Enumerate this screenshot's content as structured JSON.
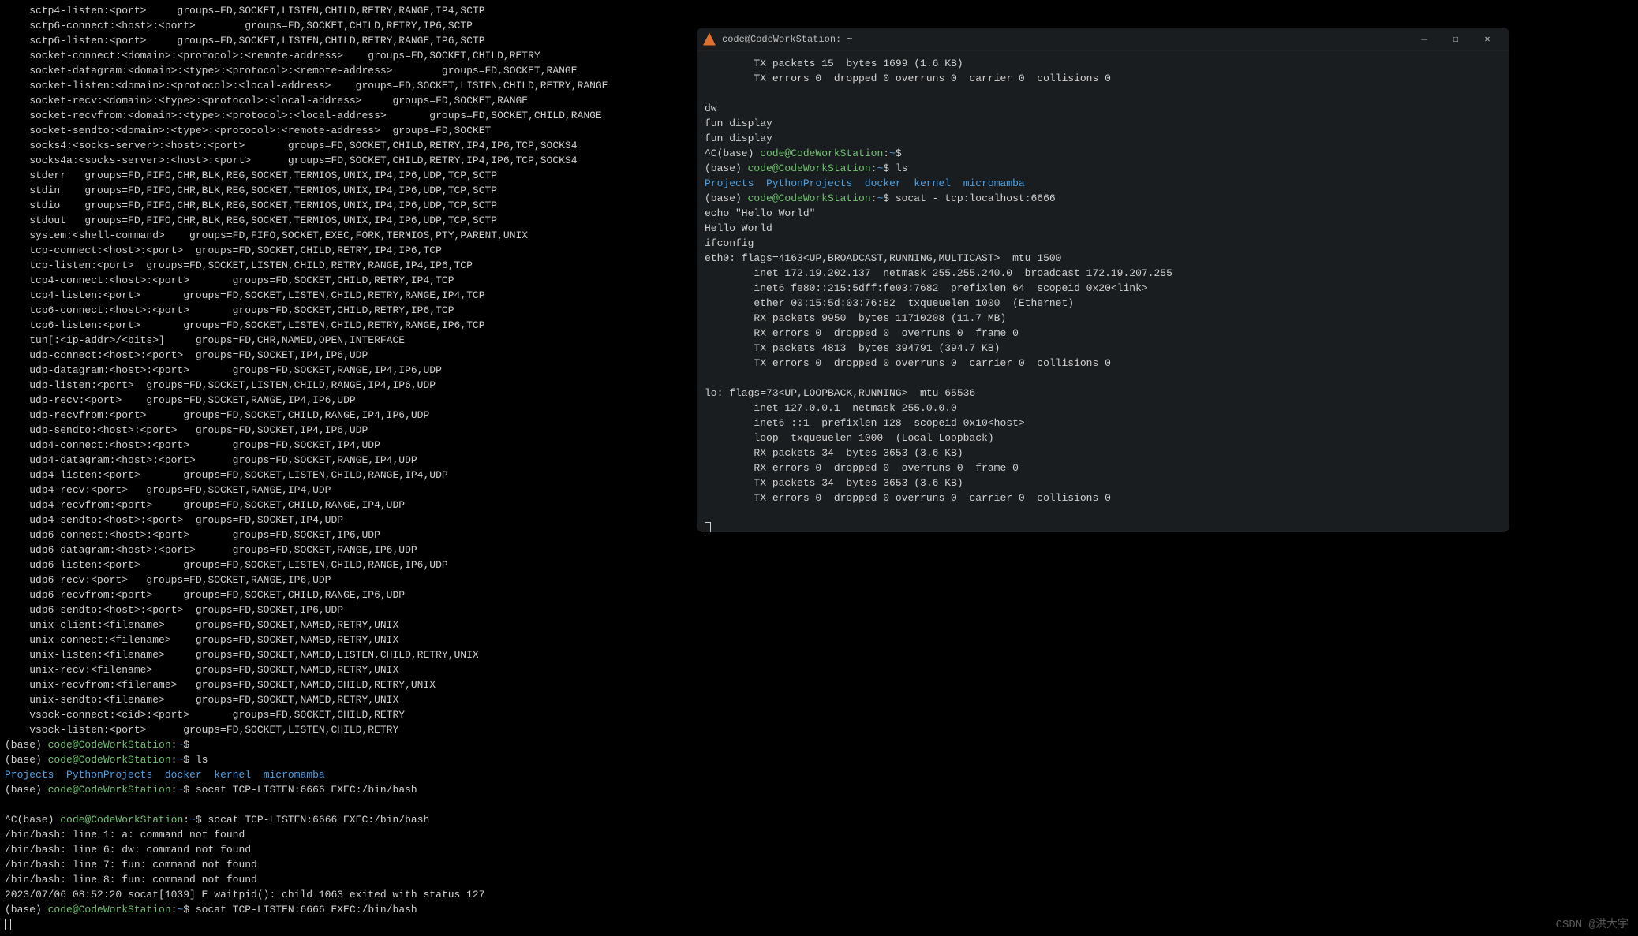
{
  "watermark": "CSDN @洪大宇",
  "main": {
    "help": [
      "    sctp4-listen:<port>     groups=FD,SOCKET,LISTEN,CHILD,RETRY,RANGE,IP4,SCTP",
      "    sctp6-connect:<host>:<port>        groups=FD,SOCKET,CHILD,RETRY,IP6,SCTP",
      "    sctp6-listen:<port>     groups=FD,SOCKET,LISTEN,CHILD,RETRY,RANGE,IP6,SCTP",
      "    socket-connect:<domain>:<protocol>:<remote-address>    groups=FD,SOCKET,CHILD,RETRY",
      "    socket-datagram:<domain>:<type>:<protocol>:<remote-address>        groups=FD,SOCKET,RANGE",
      "    socket-listen:<domain>:<protocol>:<local-address>    groups=FD,SOCKET,LISTEN,CHILD,RETRY,RANGE",
      "    socket-recv:<domain>:<type>:<protocol>:<local-address>     groups=FD,SOCKET,RANGE",
      "    socket-recvfrom:<domain>:<type>:<protocol>:<local-address>       groups=FD,SOCKET,CHILD,RANGE",
      "    socket-sendto:<domain>:<type>:<protocol>:<remote-address>  groups=FD,SOCKET",
      "    socks4:<socks-server>:<host>:<port>       groups=FD,SOCKET,CHILD,RETRY,IP4,IP6,TCP,SOCKS4",
      "    socks4a:<socks-server>:<host>:<port>      groups=FD,SOCKET,CHILD,RETRY,IP4,IP6,TCP,SOCKS4",
      "    stderr   groups=FD,FIFO,CHR,BLK,REG,SOCKET,TERMIOS,UNIX,IP4,IP6,UDP,TCP,SCTP",
      "    stdin    groups=FD,FIFO,CHR,BLK,REG,SOCKET,TERMIOS,UNIX,IP4,IP6,UDP,TCP,SCTP",
      "    stdio    groups=FD,FIFO,CHR,BLK,REG,SOCKET,TERMIOS,UNIX,IP4,IP6,UDP,TCP,SCTP",
      "    stdout   groups=FD,FIFO,CHR,BLK,REG,SOCKET,TERMIOS,UNIX,IP4,IP6,UDP,TCP,SCTP",
      "    system:<shell-command>    groups=FD,FIFO,SOCKET,EXEC,FORK,TERMIOS,PTY,PARENT,UNIX",
      "    tcp-connect:<host>:<port>  groups=FD,SOCKET,CHILD,RETRY,IP4,IP6,TCP",
      "    tcp-listen:<port>  groups=FD,SOCKET,LISTEN,CHILD,RETRY,RANGE,IP4,IP6,TCP",
      "    tcp4-connect:<host>:<port>       groups=FD,SOCKET,CHILD,RETRY,IP4,TCP",
      "    tcp4-listen:<port>       groups=FD,SOCKET,LISTEN,CHILD,RETRY,RANGE,IP4,TCP",
      "    tcp6-connect:<host>:<port>       groups=FD,SOCKET,CHILD,RETRY,IP6,TCP",
      "    tcp6-listen:<port>       groups=FD,SOCKET,LISTEN,CHILD,RETRY,RANGE,IP6,TCP",
      "    tun[:<ip-addr>/<bits>]     groups=FD,CHR,NAMED,OPEN,INTERFACE",
      "    udp-connect:<host>:<port>  groups=FD,SOCKET,IP4,IP6,UDP",
      "    udp-datagram:<host>:<port>       groups=FD,SOCKET,RANGE,IP4,IP6,UDP",
      "    udp-listen:<port>  groups=FD,SOCKET,LISTEN,CHILD,RANGE,IP4,IP6,UDP",
      "    udp-recv:<port>    groups=FD,SOCKET,RANGE,IP4,IP6,UDP",
      "    udp-recvfrom:<port>      groups=FD,SOCKET,CHILD,RANGE,IP4,IP6,UDP",
      "    udp-sendto:<host>:<port>   groups=FD,SOCKET,IP4,IP6,UDP",
      "    udp4-connect:<host>:<port>       groups=FD,SOCKET,IP4,UDP",
      "    udp4-datagram:<host>:<port>      groups=FD,SOCKET,RANGE,IP4,UDP",
      "    udp4-listen:<port>       groups=FD,SOCKET,LISTEN,CHILD,RANGE,IP4,UDP",
      "    udp4-recv:<port>   groups=FD,SOCKET,RANGE,IP4,UDP",
      "    udp4-recvfrom:<port>     groups=FD,SOCKET,CHILD,RANGE,IP4,UDP",
      "    udp4-sendto:<host>:<port>  groups=FD,SOCKET,IP4,UDP",
      "    udp6-connect:<host>:<port>       groups=FD,SOCKET,IP6,UDP",
      "    udp6-datagram:<host>:<port>      groups=FD,SOCKET,RANGE,IP6,UDP",
      "    udp6-listen:<port>       groups=FD,SOCKET,LISTEN,CHILD,RANGE,IP6,UDP",
      "    udp6-recv:<port>   groups=FD,SOCKET,RANGE,IP6,UDP",
      "    udp6-recvfrom:<port>     groups=FD,SOCKET,CHILD,RANGE,IP6,UDP",
      "    udp6-sendto:<host>:<port>  groups=FD,SOCKET,IP6,UDP",
      "    unix-client:<filename>     groups=FD,SOCKET,NAMED,RETRY,UNIX",
      "    unix-connect:<filename>    groups=FD,SOCKET,NAMED,RETRY,UNIX",
      "    unix-listen:<filename>     groups=FD,SOCKET,NAMED,LISTEN,CHILD,RETRY,UNIX",
      "    unix-recv:<filename>       groups=FD,SOCKET,NAMED,RETRY,UNIX",
      "    unix-recvfrom:<filename>   groups=FD,SOCKET,NAMED,CHILD,RETRY,UNIX",
      "    unix-sendto:<filename>     groups=FD,SOCKET,NAMED,RETRY,UNIX",
      "    vsock-connect:<cid>:<port>       groups=FD,SOCKET,CHILD,RETRY",
      "    vsock-listen:<port>      groups=FD,SOCKET,LISTEN,CHILD,RETRY"
    ],
    "prompts": [
      {
        "prefix": "(base) ",
        "user": "code@CodeWorkStation",
        "colon": ":",
        "path": "~",
        "dollar": "$",
        "cmd": ""
      },
      {
        "prefix": "(base) ",
        "user": "code@CodeWorkStation",
        "colon": ":",
        "path": "~",
        "dollar": "$",
        "cmd": " ls"
      }
    ],
    "ls": [
      "Projects",
      "PythonProjects",
      "docker",
      "kernel",
      "micromamba"
    ],
    "after_ls": {
      "prefix": "(base) ",
      "user": "code@CodeWorkStation",
      "colon": ":",
      "path": "~",
      "dollar": "$",
      "cmd": " socat TCP-LISTEN:6666 EXEC:/bin/bash"
    },
    "blank": "",
    "prompt2": {
      "prefix": "^C(base) ",
      "user": "code@CodeWorkStation",
      "colon": ":",
      "path": "~",
      "dollar": "$",
      "cmd": " socat TCP-LISTEN:6666 EXEC:/bin/bash"
    },
    "errors": [
      "/bin/bash: line 1: a: command not found",
      "/bin/bash: line 6: dw: command not found",
      "/bin/bash: line 7: fun: command not found",
      "/bin/bash: line 8: fun: command not found",
      "2023/07/06 08:52:20 socat[1039] E waitpid(): child 1063 exited with status 127"
    ],
    "last_prompt": {
      "prefix": "(base) ",
      "user": "code@CodeWorkStation",
      "colon": ":",
      "path": "~",
      "dollar": "$",
      "cmd": " socat TCP-LISTEN:6666 EXEC:/bin/bash"
    }
  },
  "window": {
    "title": "code@CodeWorkStation: ~",
    "lines_top": [
      "        TX packets 15  bytes 1699 (1.6 KB)",
      "        TX errors 0  dropped 0 overruns 0  carrier 0  collisions 0",
      "",
      "dw",
      "fun display",
      "fun display"
    ],
    "prompt1": {
      "prefix": "^C(base) ",
      "user": "code@CodeWorkStation",
      "colon": ":",
      "path": "~",
      "dollar": "$",
      "cmd": ""
    },
    "prompt2": {
      "prefix": "(base) ",
      "user": "code@CodeWorkStation",
      "colon": ":",
      "path": "~",
      "dollar": "$",
      "cmd": " ls"
    },
    "ls": [
      "Projects",
      "PythonProjects",
      "docker",
      "kernel",
      "micromamba"
    ],
    "prompt3": {
      "prefix": "(base) ",
      "user": "code@CodeWorkStation",
      "colon": ":",
      "path": "~",
      "dollar": "$",
      "cmd": " socat - tcp:localhost:6666"
    },
    "after": [
      "echo \"Hello World\"",
      "Hello World",
      "ifconfig",
      "eth0: flags=4163<UP,BROADCAST,RUNNING,MULTICAST>  mtu 1500",
      "        inet 172.19.202.137  netmask 255.255.240.0  broadcast 172.19.207.255",
      "        inet6 fe80::215:5dff:fe03:7682  prefixlen 64  scopeid 0x20<link>",
      "        ether 00:15:5d:03:76:82  txqueuelen 1000  (Ethernet)",
      "        RX packets 9950  bytes 11710208 (11.7 MB)",
      "        RX errors 0  dropped 0  overruns 0  frame 0",
      "        TX packets 4813  bytes 394791 (394.7 KB)",
      "        TX errors 0  dropped 0 overruns 0  carrier 0  collisions 0",
      "",
      "lo: flags=73<UP,LOOPBACK,RUNNING>  mtu 65536",
      "        inet 127.0.0.1  netmask 255.0.0.0",
      "        inet6 ::1  prefixlen 128  scopeid 0x10<host>",
      "        loop  txqueuelen 1000  (Local Loopback)",
      "        RX packets 34  bytes 3653 (3.6 KB)",
      "        RX errors 0  dropped 0  overruns 0  frame 0",
      "        TX packets 34  bytes 3653 (3.6 KB)",
      "        TX errors 0  dropped 0 overruns 0  carrier 0  collisions 0",
      ""
    ]
  },
  "icons": {
    "minimize": "—",
    "maximize": "☐",
    "close": "✕"
  }
}
